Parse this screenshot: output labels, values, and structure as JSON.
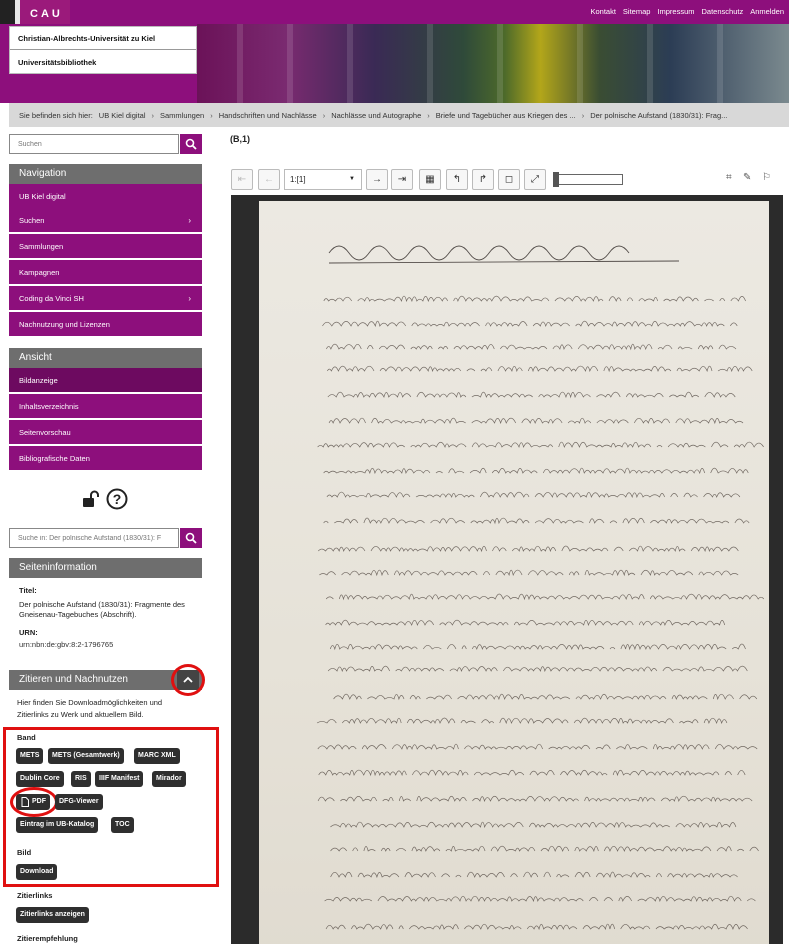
{
  "header": {
    "logo_text": "CAU",
    "topnav": [
      "Kontakt",
      "Sitemap",
      "Impressum",
      "Datenschutz",
      "Anmelden"
    ],
    "university": "Christian-Albrechts-Universität zu Kiel",
    "library": "Universitätsbibliothek"
  },
  "breadcrumb": {
    "items": [
      "Sie befinden sich hier:",
      "UB Kiel digital",
      "Sammlungen",
      "Handschriften und Nachlässe",
      "Nachlässe und Autographe",
      "Briefe und Tagebücher aus Kriegen des ...",
      "Der polnische Aufstand (1830/31): Frag..."
    ]
  },
  "search": {
    "placeholder": "Suchen"
  },
  "navigation": {
    "heading": "Navigation",
    "items": [
      {
        "label": "UB Kiel digital",
        "chevron": ""
      },
      {
        "label": "Suchen",
        "chevron": "›"
      },
      {
        "label": "Sammlungen",
        "chevron": ""
      },
      {
        "label": "Kampagnen",
        "chevron": ""
      },
      {
        "label": "Coding da Vinci SH",
        "chevron": "›"
      },
      {
        "label": "Nachnutzung und Lizenzen",
        "chevron": ""
      }
    ]
  },
  "ansicht": {
    "heading": "Ansicht",
    "items": [
      {
        "label": "Bildanzeige"
      },
      {
        "label": "Inhaltsverzeichnis"
      },
      {
        "label": "Seitenvorschau"
      },
      {
        "label": "Bibliografische Daten"
      }
    ]
  },
  "search_in": {
    "placeholder": "Suche in: Der polnische Aufstand (1830/31): F"
  },
  "seiteninfo": {
    "heading": "Seiteninformation",
    "title_label": "Titel:",
    "title_line1": "Der polnische Aufstand (1830/31): Fragmente des",
    "title_line2": "Gneisenau-Tagebuches (Abschrift).",
    "urn_label": "URN:",
    "urn": "urn:nbn:de:gbv:8:2-1796765"
  },
  "zitieren": {
    "heading": "Zitieren und Nachnutzen",
    "desc_line1": "Hier finden Sie Downloadmöglichkeiten und",
    "desc_line2": "Zitierlinks zu Werk und aktuellem Bild.",
    "band_label": "Band",
    "band_tags": [
      "METS",
      "METS (Gesamtwerk)",
      "MARC XML",
      "Dublin Core",
      "RIS",
      "IIIF Manifest",
      "Mirador",
      "PDF",
      "DFG-Viewer",
      "Eintrag im UB-Katalog",
      "TOC"
    ],
    "bild_label": "Bild",
    "bild_download": "Download",
    "zitierlinks_label": "Zitierlinks",
    "zitierlinks_btn": "Zitierlinks anzeigen",
    "zitierempfehlung_label": "Zitierempfehlung"
  },
  "viewer": {
    "page_label": "(B,1)",
    "page_select": "1:[1]"
  },
  "colors": {
    "accent": "#8d0f7c",
    "section_head": "#6e6e6e",
    "highlight": "#e01010"
  }
}
